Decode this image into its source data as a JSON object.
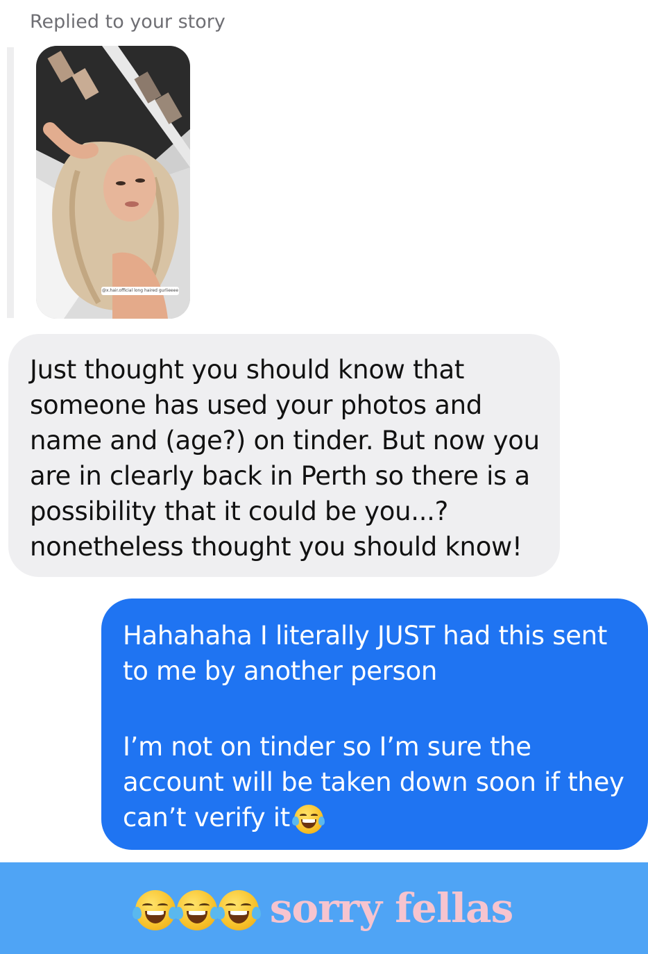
{
  "reply_header": {
    "label": "Replied to your story"
  },
  "story": {
    "caption": "@x.hair.official long haired gurlieeee",
    "image_alt": "story-photo"
  },
  "received_message": {
    "lines": [
      "Just thought you should know that",
      "someone has used your photos and",
      "name and (age?) on tinder. But now you",
      "are in clearly back in Perth so there is a",
      "possibility that it could be you...?",
      "nonetheless thought you should know!"
    ]
  },
  "sent_message": {
    "paragraph1": [
      "Hahahaha I literally JUST had this sent",
      "to me by another person"
    ],
    "paragraph2": [
      "I’m not on tinder so I’m sure the",
      "account will be taken down soon if they",
      "can’t verify it"
    ],
    "emoji": "face-with-tears-of-joy"
  },
  "footer": {
    "text": "sorry fellas",
    "emojis": [
      "face-with-tears-of-joy",
      "face-with-tears-of-joy",
      "face-with-tears-of-joy"
    ]
  },
  "colors": {
    "sent_bubble": "#1f74f2",
    "received_bubble": "#efeff1",
    "footer_bg": "#4fa4f5",
    "footer_text": "#f6c4cf"
  }
}
